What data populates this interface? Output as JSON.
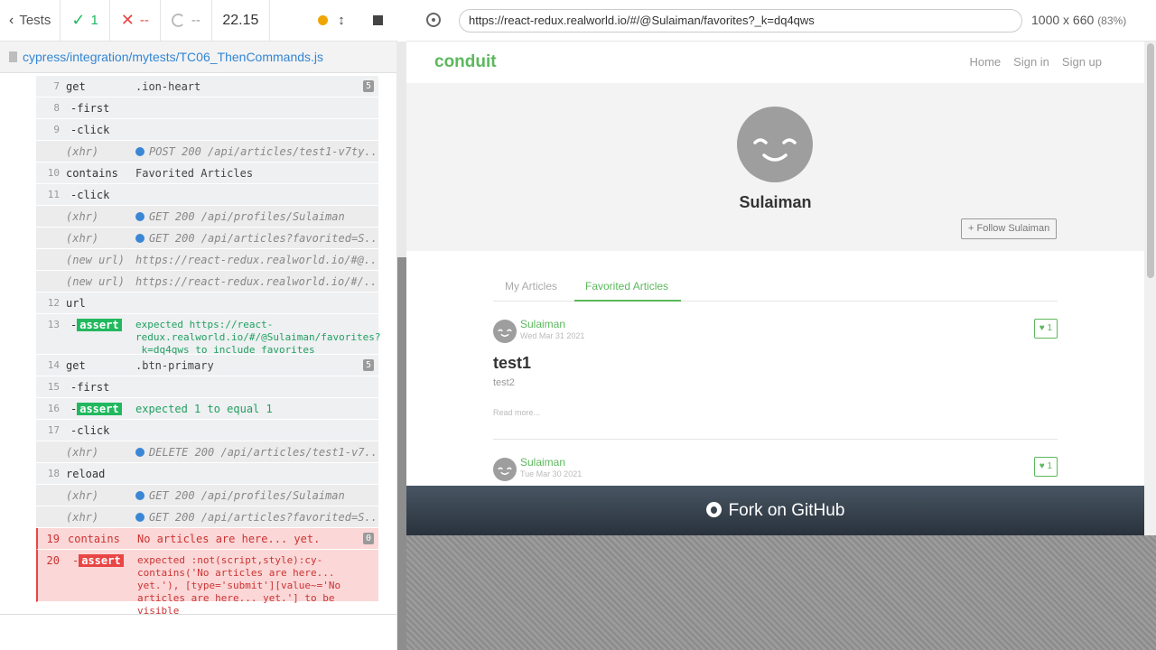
{
  "stats": {
    "tests_label": "Tests",
    "passed": "1",
    "failed": "--",
    "pending": "--",
    "duration": "22.15"
  },
  "spec": {
    "path": "cypress/integration/mytests/TC06_ThenCommands.js"
  },
  "commands": [
    {
      "ln": "7",
      "name": "get",
      "msg": ".ion-heart",
      "badge": "5"
    },
    {
      "ln": "8",
      "name": "-first",
      "msg": ""
    },
    {
      "ln": "9",
      "name": "-click",
      "msg": ""
    },
    {
      "ln": "",
      "name": "(xhr)",
      "msg": "POST 200 /api/articles/test1-v7ty..."
    },
    {
      "ln": "10",
      "name": "contains",
      "msg": "Favorited Articles"
    },
    {
      "ln": "11",
      "name": "-click",
      "msg": ""
    },
    {
      "ln": "",
      "name": "(xhr)",
      "msg": "GET 200 /api/profiles/Sulaiman"
    },
    {
      "ln": "",
      "name": "(xhr)",
      "msg": "GET 200 /api/articles?favorited=S..."
    },
    {
      "ln": "",
      "name": "(new url)",
      "msg": "https://react-redux.realworld.io/#@..."
    },
    {
      "ln": "",
      "name": "(new url)",
      "msg": "https://react-redux.realworld.io/#/..."
    },
    {
      "ln": "12",
      "name": "url",
      "msg": ""
    },
    {
      "ln": "13",
      "name": "-",
      "assert": "assert",
      "msg": "expected https://react-redux.realworld.io/#/@Sulaiman/favorites?_k=dq4qws to include favorites"
    },
    {
      "ln": "14",
      "name": "get",
      "msg": ".btn-primary",
      "badge": "5"
    },
    {
      "ln": "15",
      "name": "-first",
      "msg": ""
    },
    {
      "ln": "16",
      "name": "-",
      "assert": "assert",
      "msg": "expected 1 to equal 1"
    },
    {
      "ln": "17",
      "name": "-click",
      "msg": ""
    },
    {
      "ln": "",
      "name": "(xhr)",
      "msg": "DELETE 200 /api/articles/test1-v7..."
    },
    {
      "ln": "18",
      "name": "reload",
      "msg": ""
    },
    {
      "ln": "",
      "name": "(xhr)",
      "msg": "GET 200 /api/profiles/Sulaiman"
    },
    {
      "ln": "",
      "name": "(xhr)",
      "msg": "GET 200 /api/articles?favorited=S..."
    },
    {
      "ln": "19",
      "name": "contains",
      "msg": "No articles are here... yet.",
      "badge": "0"
    },
    {
      "ln": "20",
      "name": "-",
      "assert": "assert",
      "msg": "expected :not(script,style):cy-contains('No articles are here... yet.'), [type='submit'][value~='No articles are here... yet.'] to be visible"
    }
  ],
  "aut": {
    "url": "https://react-redux.realworld.io/#/@Sulaiman/favorites?_k=dq4qws",
    "viewport": "1000 x 660",
    "zoom": "(83%)"
  },
  "app": {
    "brand": "conduit",
    "nav": [
      "Home",
      "Sign in",
      "Sign up"
    ],
    "username": "Sulaiman",
    "follow_label": "+ Follow Sulaiman",
    "tabs": [
      "My Articles",
      "Favorited Articles"
    ],
    "articles": [
      {
        "author": "Sulaiman",
        "date": "Wed Mar 31 2021",
        "likes": "1",
        "title": "test1",
        "desc": "test2",
        "more": "Read more..."
      },
      {
        "author": "Sulaiman",
        "date": "Tue Mar 30 2021",
        "likes": "1"
      }
    ],
    "fork_label": "Fork on GitHub"
  }
}
